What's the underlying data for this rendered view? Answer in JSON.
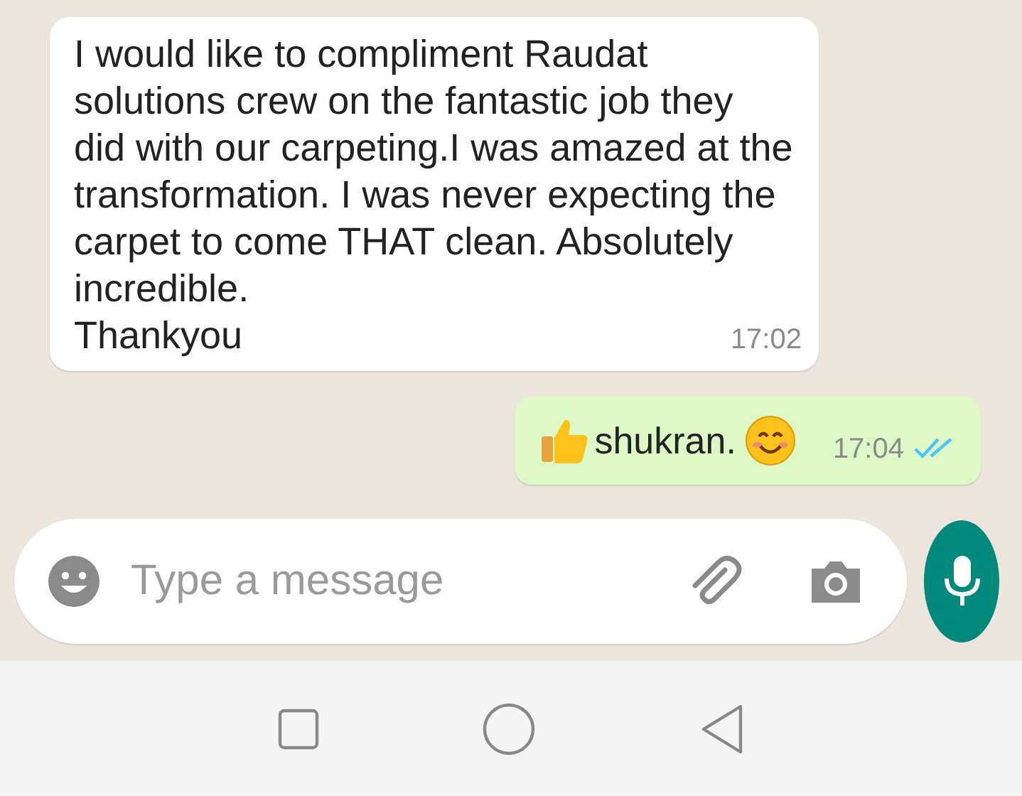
{
  "messages": [
    {
      "kind": "incoming",
      "paragraphs": [
        "I would like to compliment Raudat\nsolutions crew on the fantastic job they\ndid with our carpeting.I was amazed at the\ntransformation. I was never expecting the\ncarpet to come THAT clean. Absolutely\nincredible.",
        "Thankyou"
      ],
      "time": "17:02"
    },
    {
      "kind": "outgoing",
      "text": "shukran.",
      "time": "17:04",
      "read": true
    }
  ],
  "composer": {
    "placeholder": "Type a message"
  }
}
